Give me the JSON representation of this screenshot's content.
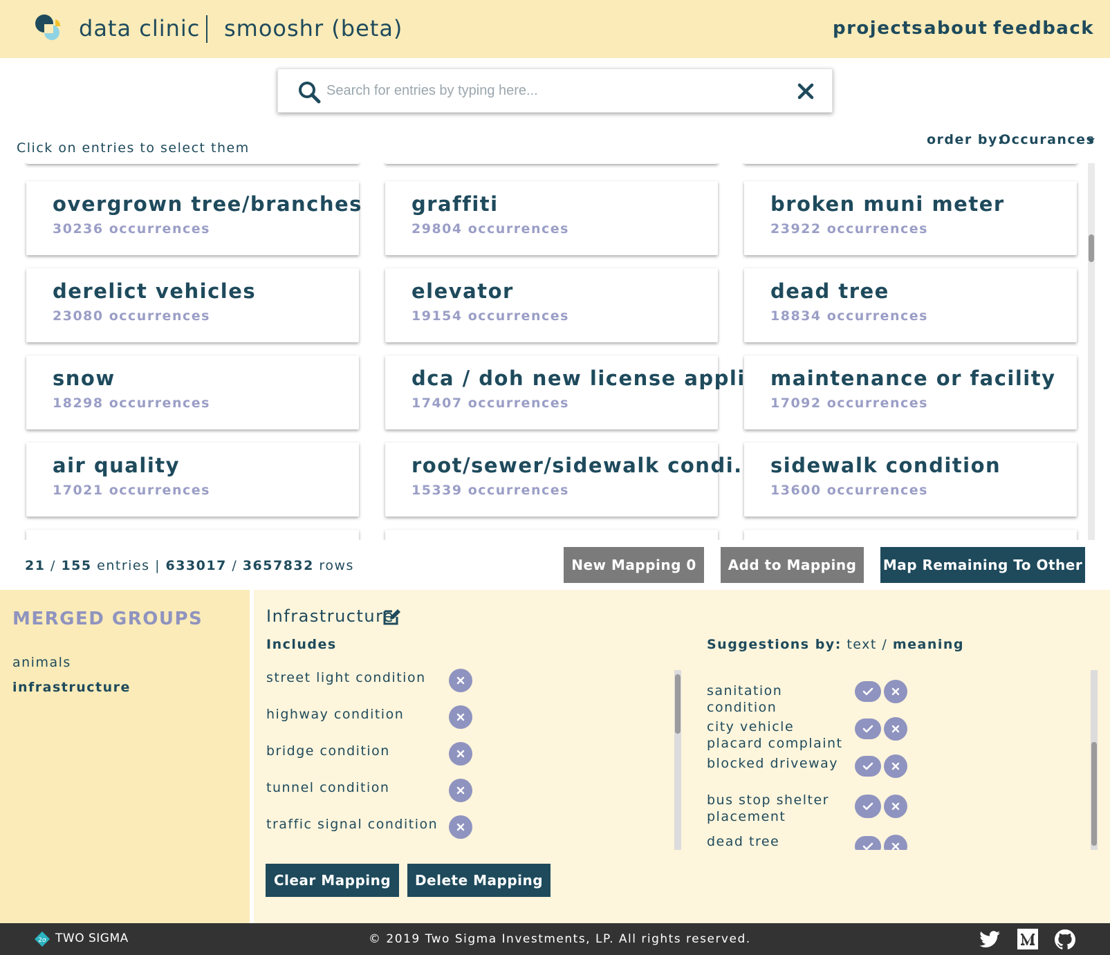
{
  "header": {
    "brand": "data clinic",
    "app_name": "smooshr (beta)",
    "nav": [
      "projects",
      "about",
      "feedback"
    ]
  },
  "search": {
    "placeholder": "Search for entries by typing here...",
    "value": ""
  },
  "hint": "Click on entries to select them",
  "order": {
    "label": "order by:",
    "value": "Occurances"
  },
  "entries": [
    {
      "title": "overgrown tree/branches",
      "count": "30236 occurrences"
    },
    {
      "title": "graffiti",
      "count": "29804 occurrences"
    },
    {
      "title": "broken muni meter",
      "count": "23922 occurrences"
    },
    {
      "title": "derelict vehicles",
      "count": "23080 occurrences"
    },
    {
      "title": "elevator",
      "count": "19154 occurrences"
    },
    {
      "title": "dead tree",
      "count": "18834 occurrences"
    },
    {
      "title": "snow",
      "count": "18298 occurrences"
    },
    {
      "title": "dca / doh new license appli...",
      "count": "17407 occurrences"
    },
    {
      "title": "maintenance or facility",
      "count": "17092 occurrences"
    },
    {
      "title": "air quality",
      "count": "17021 occurrences"
    },
    {
      "title": "root/sewer/sidewalk condi...",
      "count": "15339 occurrences"
    },
    {
      "title": "sidewalk condition",
      "count": "13600 occurrences"
    }
  ],
  "stats": {
    "selected": "21",
    "total_entries": "155",
    "entries_word": "entries",
    "rows_selected": "633017",
    "total_rows": "3657832",
    "rows_word": "rows"
  },
  "buttons": {
    "new_mapping": "New Mapping 0",
    "add_to_mapping": "Add to Mapping",
    "map_remaining": "Map Remaining To Other",
    "clear_mapping": "Clear Mapping",
    "delete_mapping": "Delete Mapping"
  },
  "groups": {
    "title": "MERGED GROUPS",
    "items": [
      "animals",
      "infrastructure"
    ],
    "selected": "infrastructure"
  },
  "mapping": {
    "name": "Infrastructure",
    "includes_label": "Includes",
    "includes": [
      "street light condition",
      "highway condition",
      "bridge condition",
      "tunnel condition",
      "traffic signal condition"
    ],
    "suggestions_prefix": "Suggestions by:",
    "suggestions_mode_text": "text",
    "suggestions_mode_meaning": "meaning",
    "suggestions": [
      "sanitation condition",
      "city vehicle placard complaint",
      "blocked driveway",
      "bus stop shelter placement",
      "dead tree"
    ]
  },
  "footer": {
    "company": "TWO SIGMA",
    "copyright": "© 2019 Two Sigma Investments, LP. All rights reserved.",
    "social_icons": [
      "twitter-icon",
      "medium-icon",
      "github-icon"
    ]
  },
  "colors": {
    "header_bg": "#faebb8",
    "primary": "#1e4a5c",
    "accent_lavender": "#8f93bf",
    "button_gray": "#7b7b7b",
    "detail_bg": "#fdf5dc",
    "footer_bg": "#333333"
  }
}
